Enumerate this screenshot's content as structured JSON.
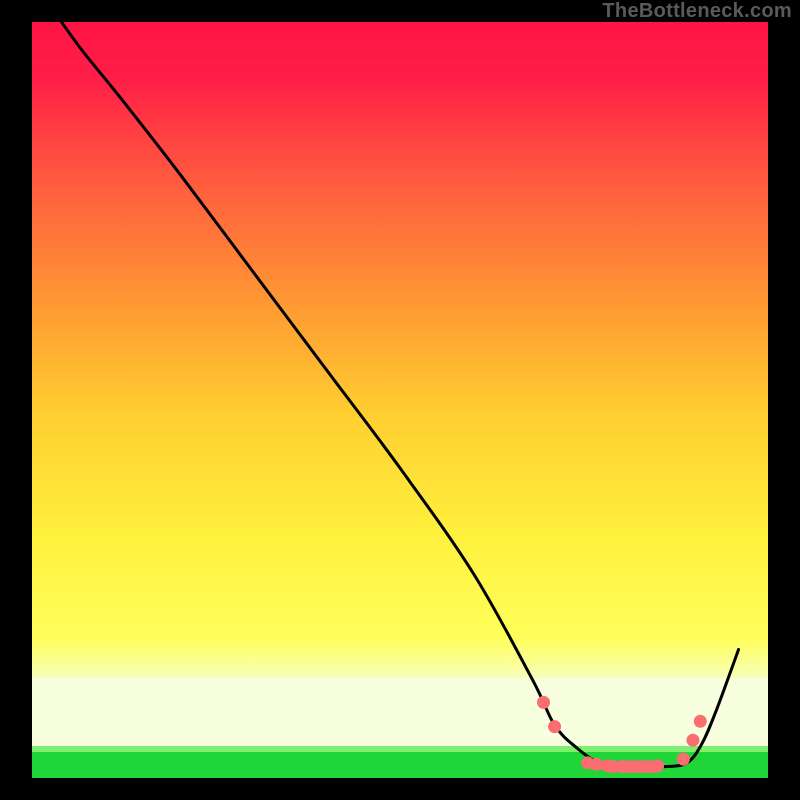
{
  "attribution": "TheBottleneck.com",
  "colors": {
    "bg": "#000000",
    "curve": "#000000",
    "marker": "#fb6d70",
    "band_green": "#1fd537",
    "band_cream": "#f7ffde",
    "top": "#ff1345",
    "mid": "#ffd733",
    "low": "#fffd56"
  },
  "chart_data": {
    "type": "line",
    "title": "",
    "xlabel": "",
    "ylabel": "",
    "xlim": [
      0,
      100
    ],
    "ylim": [
      0,
      100
    ],
    "grid": false,
    "legend": false,
    "background": "red-yellow-green vertical gradient with narrow green band at bottom",
    "series": [
      {
        "name": "curve",
        "x": [
          4,
          7,
          12,
          20,
          30,
          40,
          50,
          60,
          68,
          71,
          74,
          77,
          80,
          83,
          86,
          89,
          91,
          93,
          96
        ],
        "y": [
          100,
          96,
          90,
          80,
          67,
          54,
          41,
          27,
          13,
          7,
          4,
          2,
          1.5,
          1.5,
          1.5,
          2,
          4.5,
          9,
          17
        ]
      }
    ],
    "markers": {
      "name": "highlighted points on curve near minimum",
      "x": [
        69.5,
        71.0,
        75.5,
        76.7,
        78.2,
        79.0,
        80.2,
        81.0,
        81.8,
        82.7,
        83.5,
        84.3,
        85.0,
        88.5,
        89.8,
        90.8
      ],
      "y": [
        10.0,
        6.8,
        2.0,
        1.8,
        1.6,
        1.5,
        1.5,
        1.5,
        1.5,
        1.5,
        1.5,
        1.5,
        1.6,
        2.5,
        5.0,
        7.5
      ]
    }
  }
}
